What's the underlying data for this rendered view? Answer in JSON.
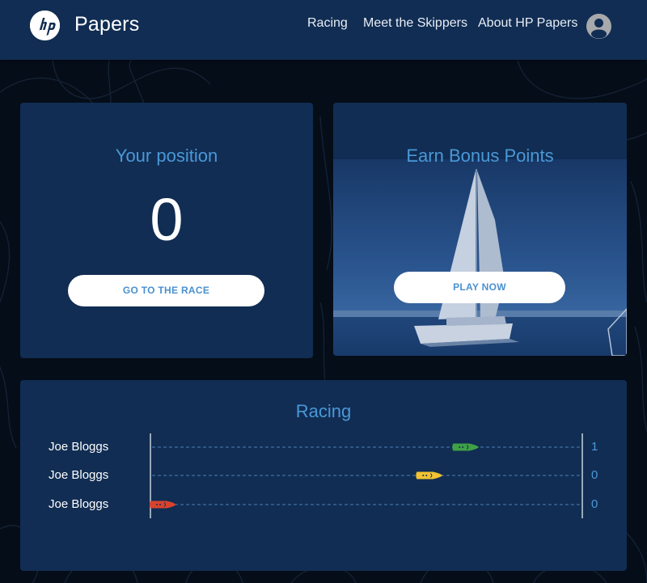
{
  "header": {
    "brand": "Papers",
    "logo_icon": "hp-logo",
    "nav": [
      {
        "label": "Racing"
      },
      {
        "label": "Meet the Skippers"
      },
      {
        "label": "About HP Papers"
      }
    ],
    "avatar_icon": "user-avatar-icon"
  },
  "position_card": {
    "title": "Your position",
    "value": "0",
    "button_label": "GO TO THE RACE"
  },
  "bonus_card": {
    "title": "Earn Bonus Points",
    "image": "sailboat-photo",
    "button_label": "PLAY NOW"
  },
  "racing": {
    "title": "Racing",
    "racers": [
      {
        "name": "Joe Bloggs",
        "score": "1",
        "progress": 0.75,
        "boat_color": "#3fa046"
      },
      {
        "name": "Joe Bloggs",
        "score": "0",
        "progress": 0.66,
        "boat_color": "#f2c232"
      },
      {
        "name": "Joe Bloggs",
        "score": "0",
        "progress": 0.0,
        "boat_color": "#d9432e"
      }
    ]
  },
  "colors": {
    "header_bg": "#112d53",
    "card_bg": "#112d53",
    "page_bg": "#050d18",
    "accent": "#4a98d8"
  }
}
